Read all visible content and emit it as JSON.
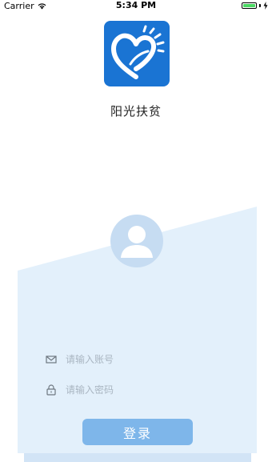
{
  "status_bar": {
    "carrier": "Carrier",
    "time": "5:34 PM"
  },
  "app": {
    "name": "阳光扶贫"
  },
  "login": {
    "account_placeholder": "请输入账号",
    "password_placeholder": "请输入密码",
    "submit_label": "登录"
  },
  "colors": {
    "brand_blue": "#1a74d3",
    "panel_light": "#e3f0fb",
    "button": "#7eb6ea"
  }
}
